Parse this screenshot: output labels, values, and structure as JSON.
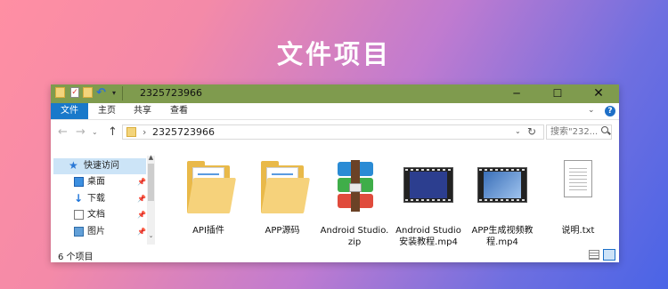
{
  "page": {
    "title": "文件项目"
  },
  "window": {
    "title": "2325723966",
    "controls": {
      "minimize": "─",
      "maximize": "☐",
      "close": "✕"
    }
  },
  "ribbon": {
    "tabs": [
      {
        "label": "文件"
      },
      {
        "label": "主页"
      },
      {
        "label": "共享"
      },
      {
        "label": "查看"
      }
    ],
    "help_label": "?"
  },
  "navigation": {
    "back_icon": "←",
    "forward_icon": "→",
    "up_icon": "↑",
    "address_path": "2325723966",
    "search_placeholder": "搜索\"232..."
  },
  "sidebar": {
    "items": [
      {
        "label": "快速访问",
        "icon": "star-icon"
      },
      {
        "label": "桌面",
        "icon": "desktop-icon"
      },
      {
        "label": "下载",
        "icon": "download-icon"
      },
      {
        "label": "文档",
        "icon": "document-icon"
      },
      {
        "label": "图片",
        "icon": "pictures-icon"
      }
    ]
  },
  "files": [
    {
      "label": "API插件",
      "icon": "folder-icon"
    },
    {
      "label": "APP源码",
      "icon": "folder-icon"
    },
    {
      "label": "Android Studio.zip",
      "icon": "winrar-archive-icon"
    },
    {
      "label": "Android Studio安装教程.mp4",
      "icon": "video-file-icon"
    },
    {
      "label": "APP生成视频教程.mp4",
      "icon": "video-file-icon"
    },
    {
      "label": "说明.txt",
      "icon": "text-file-icon"
    }
  ],
  "status": {
    "item_count": "6 个项目"
  },
  "colors": {
    "titlebar": "#7f9b4e",
    "file_tab": "#1979ca",
    "selected_item": "#cce4f7"
  }
}
